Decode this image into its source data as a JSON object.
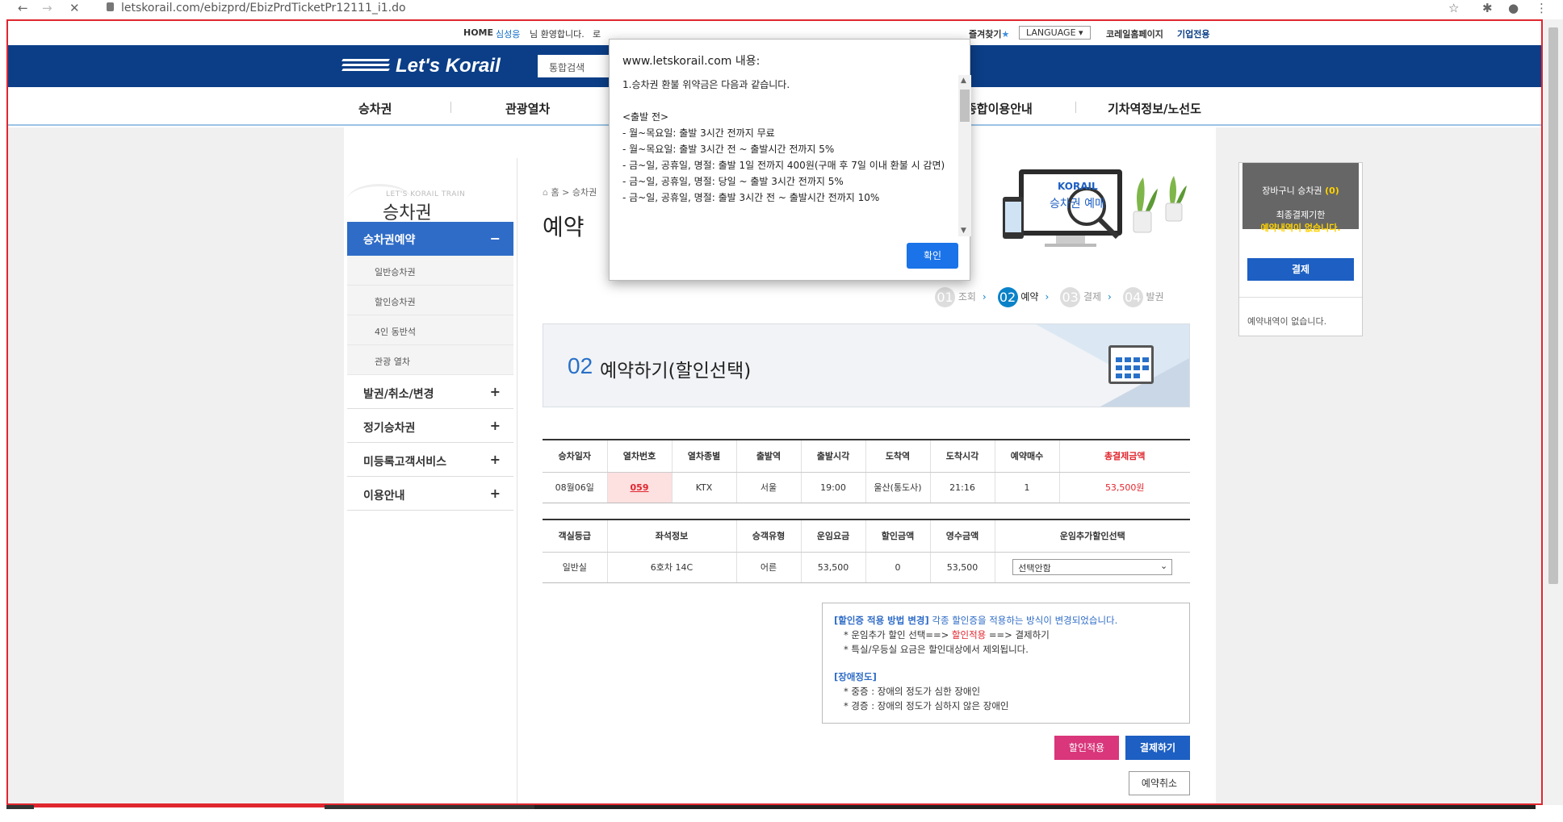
{
  "browser": {
    "url": "letskorail.com/ebizprd/EbizPrdTicketPr12111_i1.do"
  },
  "util_bar": {
    "home": "HOME",
    "user_name": "심성응",
    "welcome": "님 환영합니다.",
    "logout_partial": "로",
    "favorites": "즐겨찾기",
    "language": "LANGUAGE",
    "korail_home": "코레일홈페이지",
    "corporate": "기업전용"
  },
  "header": {
    "logo": "Let's Korail",
    "search_label": "통합검색"
  },
  "main_nav": {
    "items": [
      "승차권",
      "관광열차",
      "종합이용안내",
      "기차역정보/노선도"
    ]
  },
  "sidebar": {
    "hero_small": "LET'S KORAIL TRAIN",
    "hero_title": "승차권",
    "active_label": "승차권예약",
    "active_symbol": "−",
    "sub_items": [
      "일반승차권",
      "할인승차권",
      "4인 동반석",
      "관광 열차"
    ],
    "categories": [
      "발권/취소/변경",
      "정기승차권",
      "미등록고객서비스",
      "이용안내"
    ],
    "plus_symbol": "+"
  },
  "breadcrumb": {
    "home": "홈",
    "sep": ">",
    "current": "승차권"
  },
  "page_title": "예약",
  "illustration": {
    "brand": "KORAIL",
    "caption": "승차권 예매"
  },
  "steps": [
    {
      "num": "01",
      "label": "조회"
    },
    {
      "num": "02",
      "label": "예약"
    },
    {
      "num": "03",
      "label": "결제"
    },
    {
      "num": "04",
      "label": "발권"
    }
  ],
  "step_arrow": "›",
  "banner": {
    "num": "02",
    "title": "예약하기(할인선택)"
  },
  "train_table": {
    "headers": [
      "승차일자",
      "열차번호",
      "열차종별",
      "출발역",
      "출발시각",
      "도착역",
      "도착시각",
      "예약매수",
      "총결제금액"
    ],
    "row": [
      "08월06일",
      "059",
      "KTX",
      "서울",
      "19:00",
      "울산(통도사)",
      "21:16",
      "1",
      "53,500원"
    ]
  },
  "fare_table": {
    "headers": [
      "객실등급",
      "좌석정보",
      "승객유형",
      "운임요금",
      "할인금액",
      "영수금액",
      "운임추가할인선택"
    ],
    "row": [
      "일반실",
      "6호차 14C",
      "어른",
      "53,500",
      "0",
      "53,500"
    ],
    "select_value": "선택안함"
  },
  "notice": {
    "line1_head": "[할인증 적용 방법 변경]",
    "line1_tail": " 각종 할인증을 적용하는 방식이 변경되었습니다.",
    "line2_a": "* 운임추가 할인 선택==> ",
    "line2_b": "할인적용",
    "line2_c": " ==> 결제하기",
    "line3": "* 특실/우등실 요금은 할인대상에서 제외됩니다.",
    "section2_head": "[장애정도]",
    "line4": "* 중증 : 장애의 정도가 심한 장애인",
    "line5": "* 경증 : 장애의 정도가 심하지 않은 장애인"
  },
  "buttons": {
    "apply_discount": "할인적용",
    "pay": "결제하기",
    "cancel_reservation": "예약취소"
  },
  "cart": {
    "title": "장바구니 승차권",
    "count": "(0)",
    "deadline_label": "최종결제기한",
    "deadline_value": "예약내역이 없습니다.",
    "pay_button": "결제",
    "empty": "예약내역이 없습니다."
  },
  "dialog": {
    "title": "www.letskorail.com 내용:",
    "body": "1.승차권 환불 위약금은 다음과 같습니다.\n\n<출발 전>\n- 월~목요일: 출발 3시간 전까지 무료\n- 월~목요일: 출발 3시간 전 ~ 출발시간 전까지 5%\n- 금~일, 공휴일, 명절: 출발 1일 전까지 400원(구매 후 7일 이내 환불 시 감면)\n- 금~일, 공휴일, 명절: 당일 ~ 출발 3시간 전까지 5%\n- 금~일, 공휴일, 명절: 출발 3시간 전 ~ 출발시간 전까지 10%",
    "ok_label": "확인"
  },
  "colors": {
    "header_blue": "#0b3e87",
    "accent_blue": "#2f6cc7",
    "alert_red": "#e0262e",
    "discount_pink": "#d9367b"
  }
}
